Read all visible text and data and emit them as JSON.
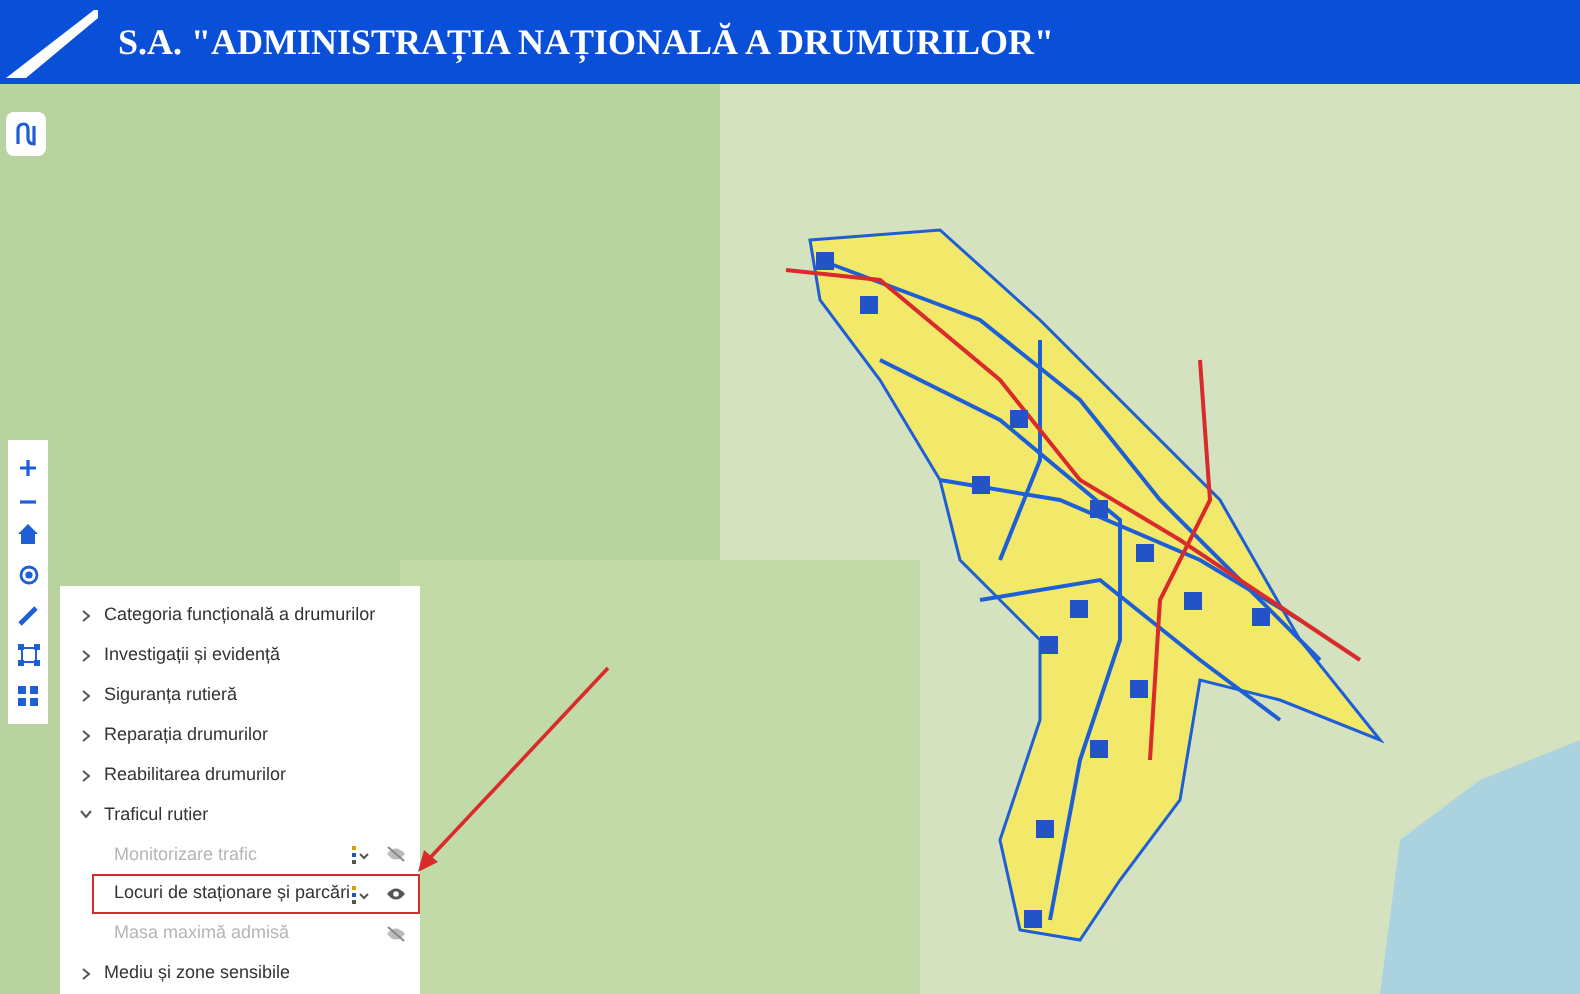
{
  "header": {
    "title": "S.A. \"ADMINISTRAȚIA NAȚIONALĂ A DRUMURILOR\""
  },
  "layers_panel": {
    "groups": [
      {
        "label": "Categoria funcțională a drumurilor",
        "expanded": false
      },
      {
        "label": "Investigații și evidență",
        "expanded": false
      },
      {
        "label": "Siguranța rutieră",
        "expanded": false
      },
      {
        "label": "Reparația drumurilor",
        "expanded": false
      },
      {
        "label": "Reabilitarea drumurilor",
        "expanded": false
      },
      {
        "label": "Traficul rutier",
        "expanded": true,
        "children": [
          {
            "label": "Monitorizare trafic",
            "visible": false,
            "highlighted": false,
            "style_menu": true
          },
          {
            "label": "Locuri de staționare și parcări",
            "visible": true,
            "highlighted": true,
            "style_menu": true
          },
          {
            "label": "Masa maximă admisă",
            "visible": false,
            "highlighted": false,
            "style_menu": false
          }
        ]
      },
      {
        "label": "Mediu și zone sensibile",
        "expanded": false
      }
    ]
  }
}
